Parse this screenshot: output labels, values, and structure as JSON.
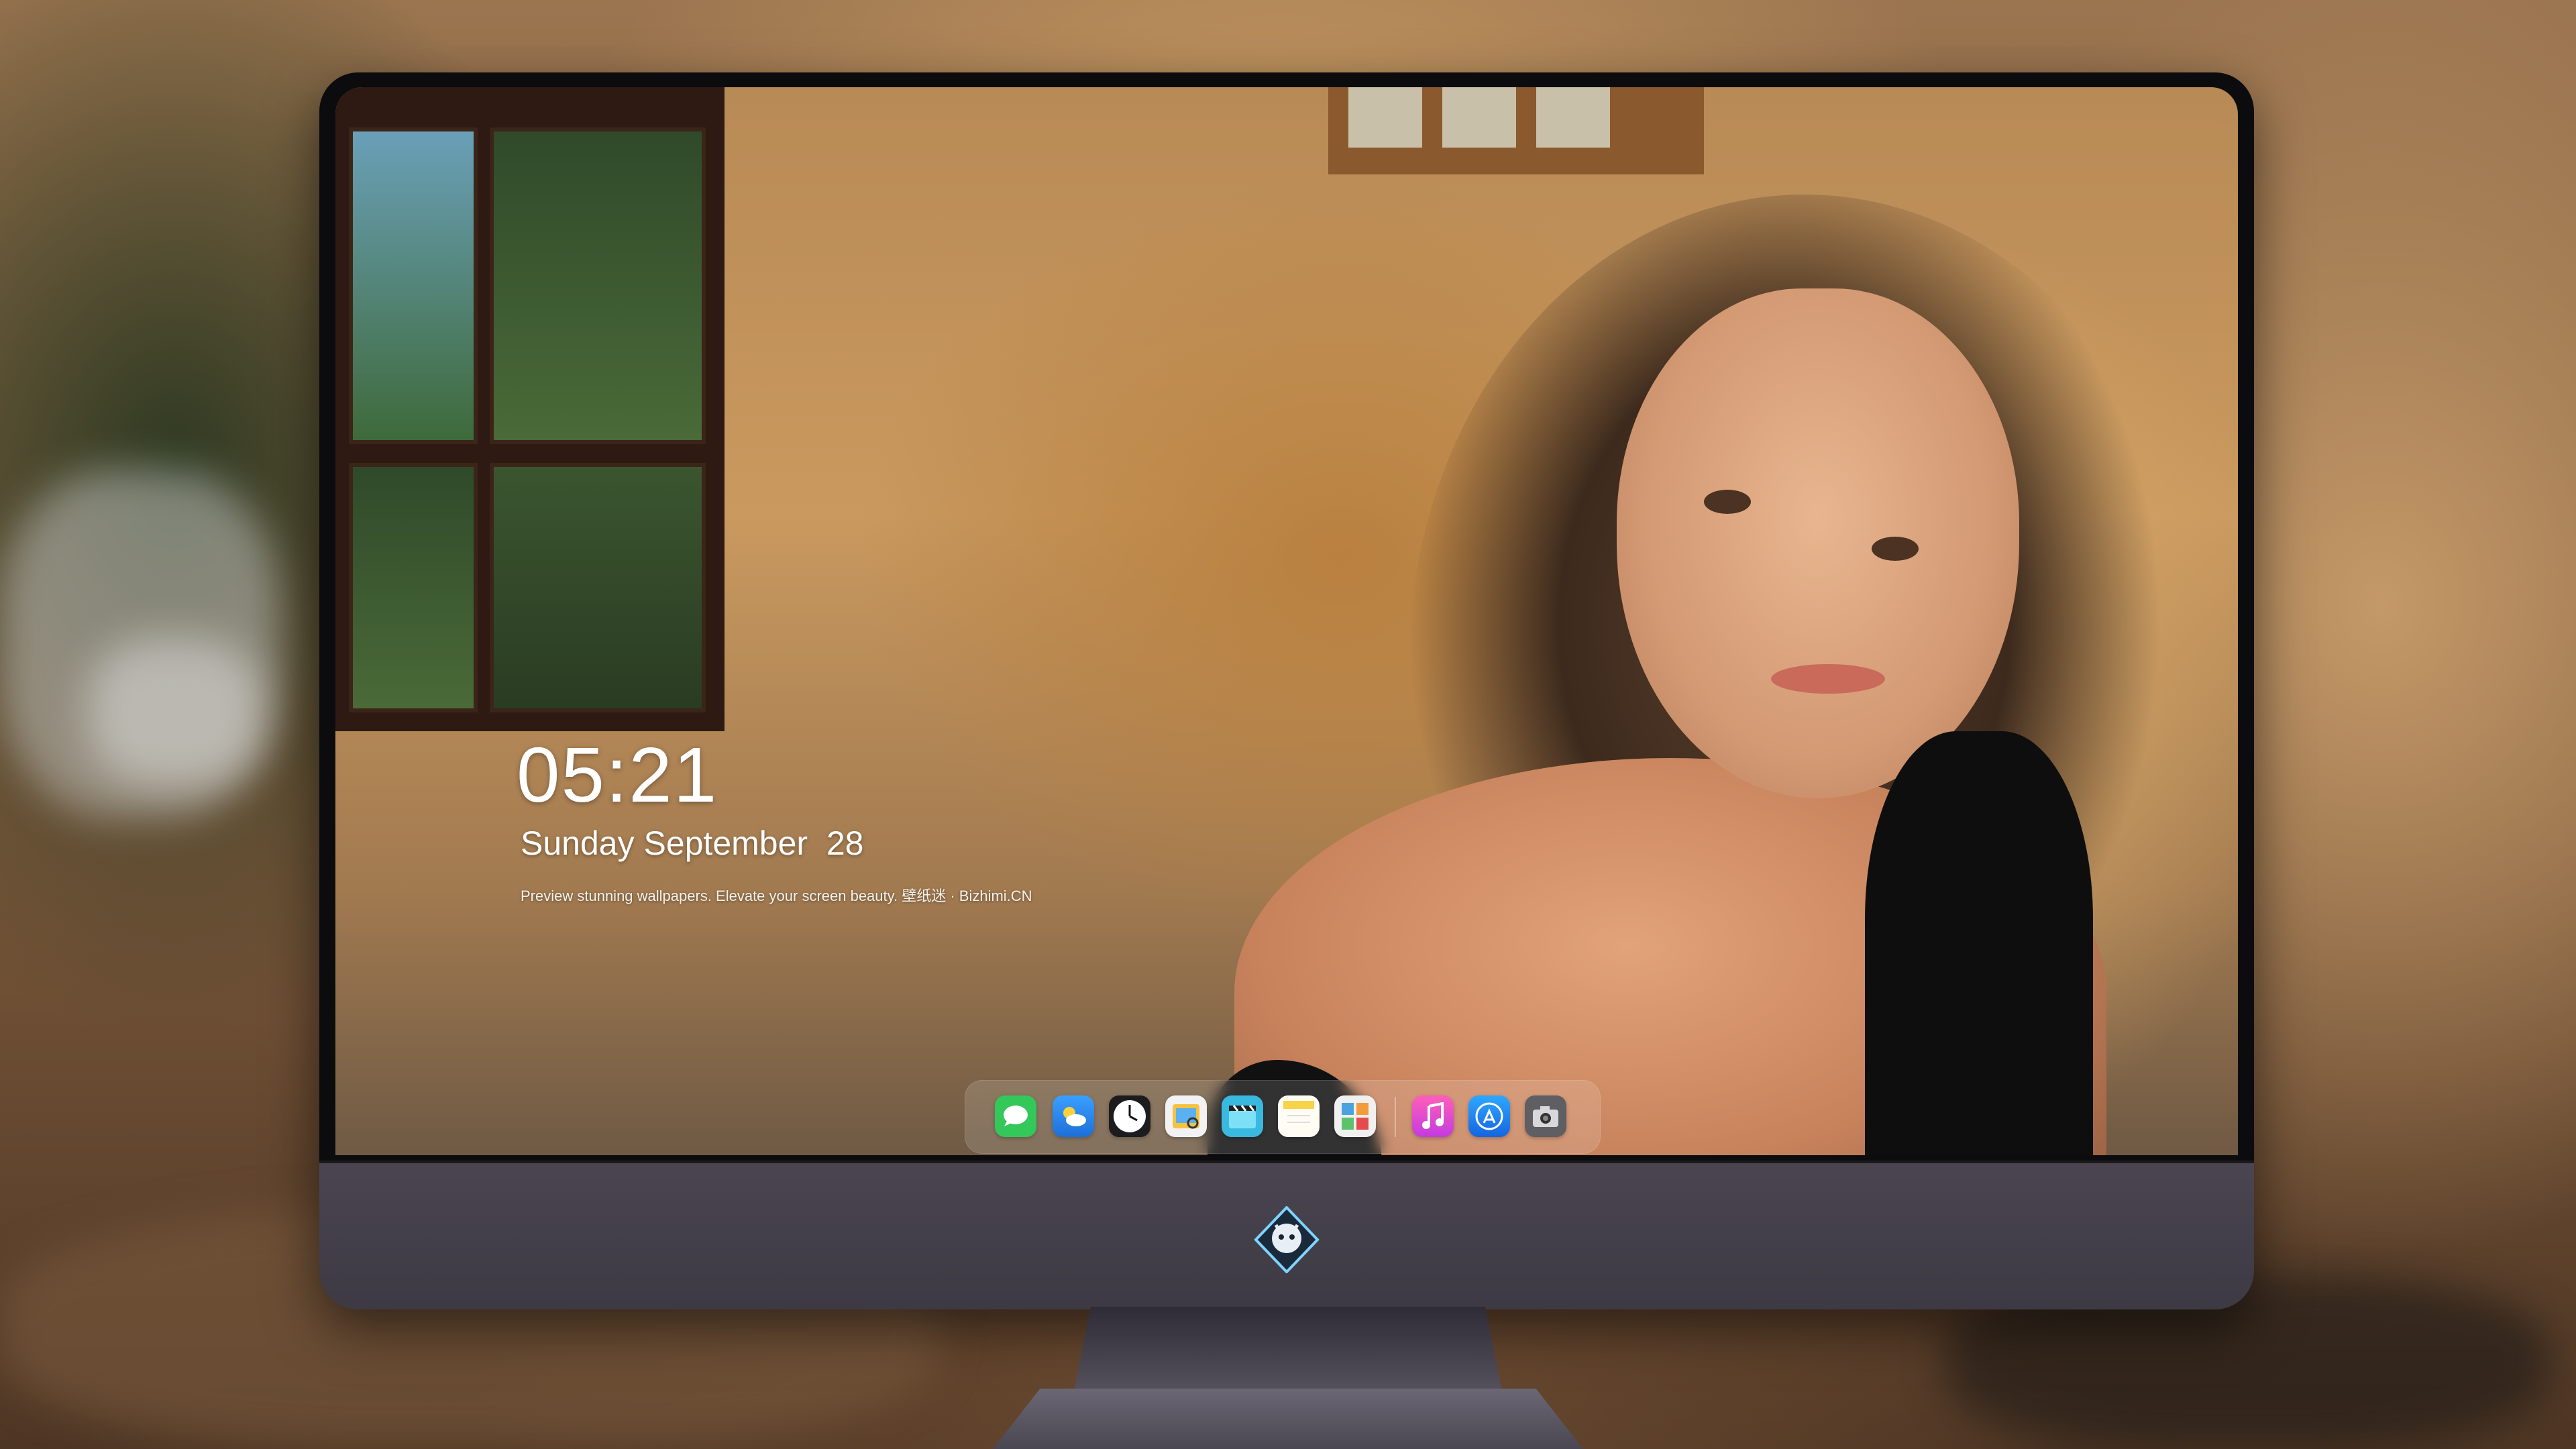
{
  "lockscreen": {
    "time": "05:21",
    "date": "Sunday September  28",
    "tagline": "Preview stunning wallpapers. Elevate your screen beauty. 壁纸迷 · Bizhimi.CN"
  },
  "dock": {
    "apps": [
      {
        "name": "messages-icon",
        "color": "#34c759"
      },
      {
        "name": "weather-icon",
        "color": "#2f8cf0"
      },
      {
        "name": "clock-icon",
        "color": "#ffffff"
      },
      {
        "name": "preview-icon",
        "color": "#f5c242"
      },
      {
        "name": "clips-icon",
        "color": "#39b9e0"
      },
      {
        "name": "notes-icon",
        "color": "#f7d34a"
      },
      {
        "name": "photos-grid-icon",
        "color": "#4aa3df"
      },
      {
        "name": "music-icon",
        "color": "#f24ab0"
      },
      {
        "name": "app-store-icon",
        "color": "#1e8cf5"
      },
      {
        "name": "camera-icon",
        "color": "#6d6d72"
      }
    ]
  },
  "monitor": {
    "logo": "mascot-logo-icon"
  }
}
